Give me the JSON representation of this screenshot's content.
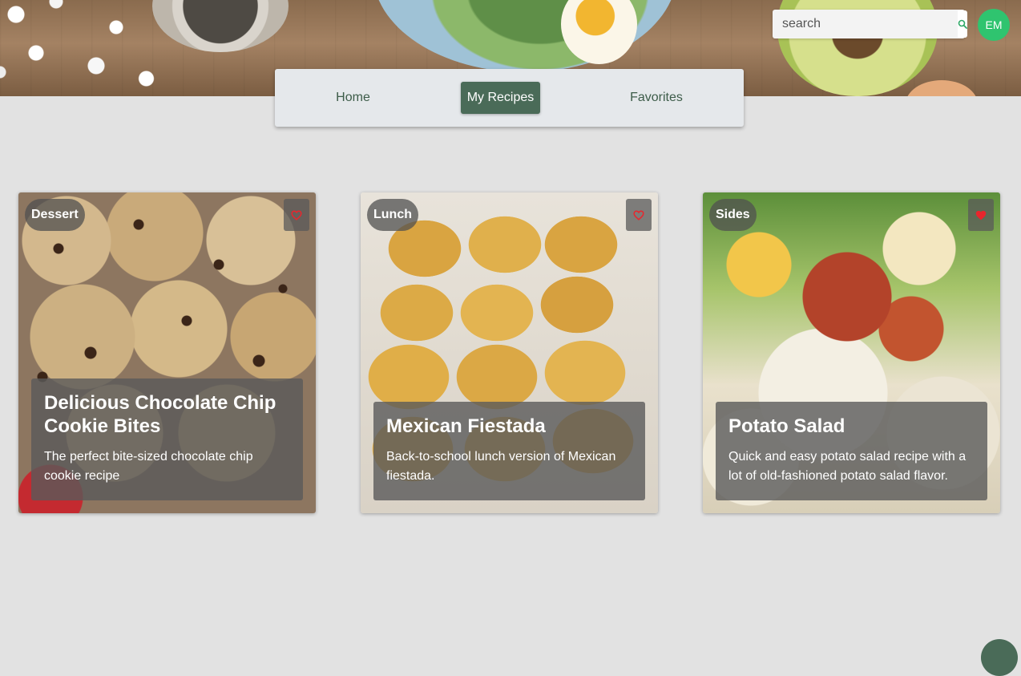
{
  "header": {
    "search_placeholder": "search",
    "avatar_initials": "EM"
  },
  "nav": {
    "items": [
      {
        "label": "Home",
        "active": false
      },
      {
        "label": "My Recipes",
        "active": true
      },
      {
        "label": "Favorites",
        "active": false
      }
    ]
  },
  "recipes": [
    {
      "category": "Dessert",
      "title": "Delicious Chocolate Chip Cookie Bites",
      "description": "The perfect bite-sized chocolate chip cookie recipe",
      "favorited": false,
      "image_icon": "cookies-photo"
    },
    {
      "category": "Lunch",
      "title": "Mexican Fiestada",
      "description": "Back-to-school lunch version of Mexican fiestada.",
      "favorited": false,
      "image_icon": "fiestada-photo"
    },
    {
      "category": "Sides",
      "title": "Potato Salad",
      "description": "Quick and easy potato salad recipe with a lot of old-fashioned potato salad flavor.",
      "favorited": true,
      "image_icon": "potato-salad-photo"
    }
  ],
  "colors": {
    "accent": "#4a6b58",
    "avatar": "#2fc46f",
    "heart": "#e8262d"
  }
}
